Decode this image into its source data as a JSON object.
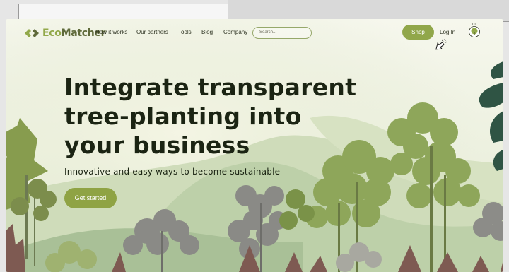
{
  "logo": {
    "part1": "Eco",
    "part2": "Matcher"
  },
  "nav": {
    "links": [
      "How it works",
      "Our partners",
      "Tools",
      "Blog",
      "Company"
    ],
    "search_placeholder": "Search...",
    "shop_label": "Shop",
    "login_label": "Log In",
    "badge_count": "10"
  },
  "hero": {
    "title_lines": [
      "Integrate transparent",
      "tree-planting into",
      "your business"
    ],
    "subtitle": "Innovative and easy ways to become sustainable",
    "cta_label": "Get started"
  },
  "colors": {
    "brand_green": "#91a74a",
    "dark_text": "#1b2413",
    "hill": "#c9d7b3"
  }
}
